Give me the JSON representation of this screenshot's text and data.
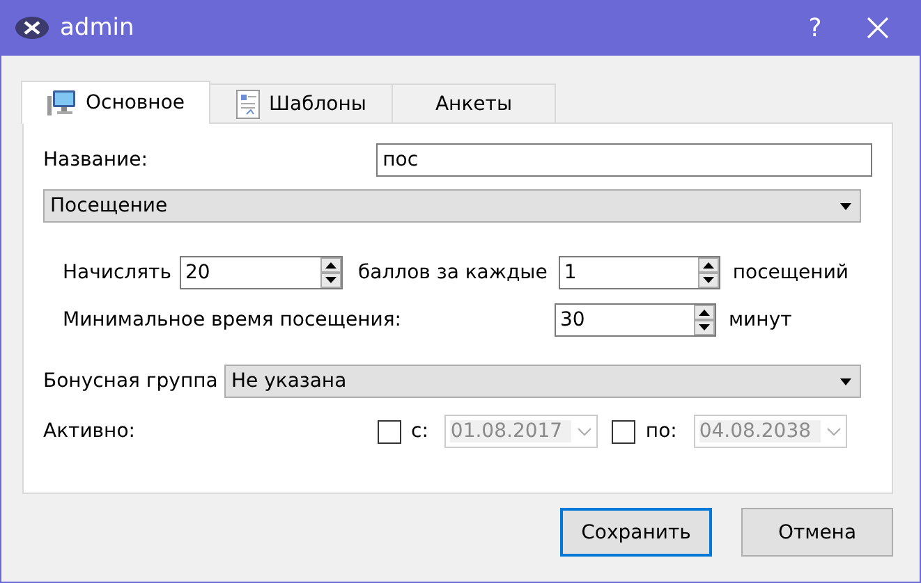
{
  "window": {
    "title": "admin",
    "help": "?"
  },
  "tabs": [
    {
      "label": "Основное",
      "kind": "monitor",
      "selected": true
    },
    {
      "label": "Шаблоны",
      "kind": "document",
      "selected": false
    },
    {
      "label": "Анкеты",
      "selected": false
    }
  ],
  "name": {
    "label": "Название:",
    "value": "пос"
  },
  "type_dropdown": {
    "value": "Посещение"
  },
  "accrual": {
    "label": "Начислять",
    "points": "20",
    "middle": "баллов за каждые",
    "visits": "1",
    "unit": "посещений"
  },
  "min_time": {
    "label": "Минимальное время посещения:",
    "value": "30",
    "unit": "минут"
  },
  "bonus_group": {
    "label": "Бонусная группа",
    "value": "Не указана"
  },
  "active": {
    "label": "Активно:",
    "from": {
      "label": "с:",
      "checked": false,
      "date": "01.08.2017",
      "disabled": true
    },
    "to": {
      "label": "по:",
      "checked": false,
      "date": "04.08.2038",
      "disabled": true
    }
  },
  "buttons": [
    {
      "label": "Сохранить",
      "focused": true
    },
    {
      "label": "Отмена",
      "focused": false
    }
  ]
}
